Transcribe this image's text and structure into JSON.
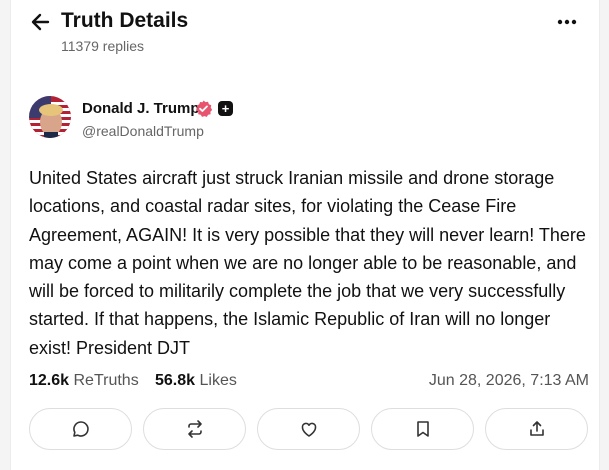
{
  "header": {
    "title": "Truth Details",
    "replies": "11379 replies"
  },
  "post": {
    "author_name": "Donald J. Trump",
    "handle": "@realDonaldTrump",
    "plus_badge": "+",
    "text": "United States aircraft just struck Iranian missile and drone storage locations, and coastal radar sites, for violating the Cease Fire Agreement, AGAIN! It is very possible that they will never learn! There may come a point when we are no longer able to be reasonable, and will be forced to militarily complete the job that we very successfully started. If that happens, the Islamic Republic of Iran will no longer exist! President DJT",
    "retruths_count": "12.6k",
    "retruths_label": "ReTruths",
    "likes_count": "56.8k",
    "likes_label": "Likes",
    "timestamp": "Jun 28, 2026, 7:13 AM"
  },
  "actions": [
    {
      "icon": "reply-icon"
    },
    {
      "icon": "retruth-icon"
    },
    {
      "icon": "like-icon"
    },
    {
      "icon": "bookmark-icon"
    },
    {
      "icon": "share-icon"
    }
  ],
  "colors": {
    "verified_badge": "#e8546f",
    "text": "#111111",
    "muted": "#666666",
    "border": "#dedede"
  }
}
